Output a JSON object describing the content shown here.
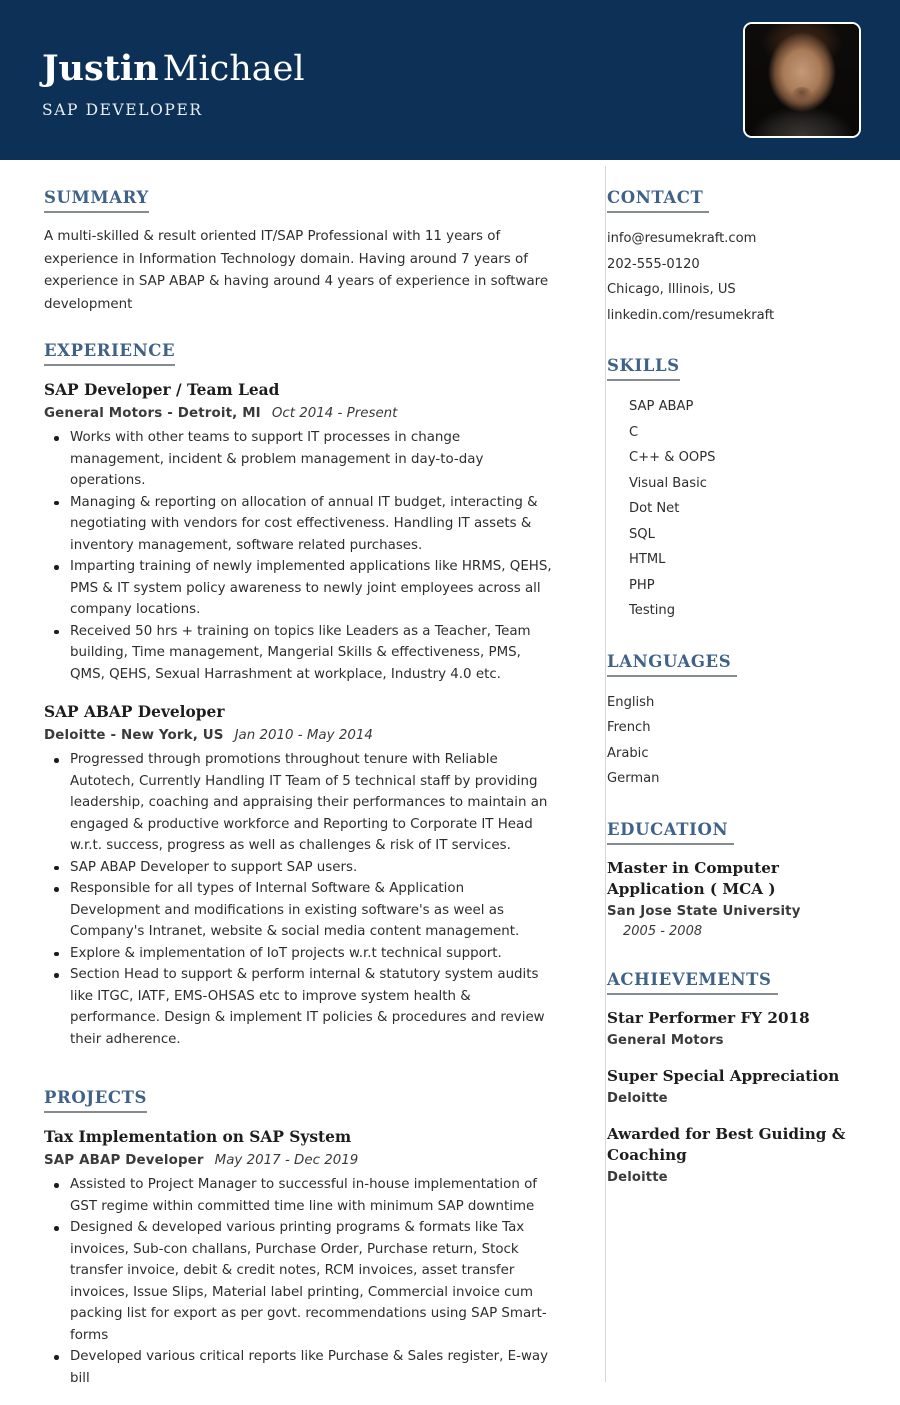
{
  "header": {
    "first_name": "Justin",
    "last_name": "Michael",
    "job_title": "SAP DEVELOPER",
    "photo_alt": "profile-photo",
    "background_color": "#0d3057"
  },
  "theme": {
    "accent": "#3f6289",
    "navy": "#0d3057",
    "rule": "#868b90",
    "divider": "#d3d7db"
  },
  "left": {
    "summary": {
      "heading": "SUMMARY",
      "text": "A multi-skilled & result oriented IT/SAP Professional with 11 years of experience in Information Technology domain. Having around 7 years of experience in SAP ABAP & having around 4 years of experience in software development"
    },
    "experience": {
      "heading": "EXPERIENCE",
      "entries": [
        {
          "title": "SAP Developer / Team Lead",
          "org": "General Motors - Detroit, MI",
          "dates": "Oct 2014 - Present",
          "bullets": [
            "Works with other teams to support IT processes in change management, incident & problem management in day-to-day operations.",
            "Managing & reporting on allocation of annual IT budget, interacting & negotiating with vendors for cost effectiveness. Handling IT assets & inventory management, software related purchases.",
            "Imparting training of newly implemented applications like HRMS, QEHS, PMS & IT system policy awareness to newly joint employees across all company locations.",
            "Received 50 hrs + training on topics like Leaders as a Teacher, Team building, Time management, Mangerial Skills & effectiveness, PMS, QMS, QEHS, Sexual Harrashment at workplace, Industry 4.0 etc."
          ]
        },
        {
          "title": "SAP ABAP Developer",
          "org": "Deloitte - New York, US",
          "dates": "Jan 2010 - May 2014",
          "bullets": [
            "Progressed through promotions throughout tenure with Reliable Autotech, Currently Handling IT Team of 5 technical staff by providing leadership, coaching and appraising their performances to maintain an engaged & productive workforce and Reporting to Corporate IT Head w.r.t. success, progress as well as challenges & risk of IT services.",
            "SAP ABAP Developer to support SAP users.",
            "Responsible for all types of Internal Software & Application Development and modifications in existing software's as weel as Company's Intranet, website & social media content management.",
            "Explore & implementation of IoT projects w.r.t technical support.",
            "Section Head to support & perform internal & statutory system audits like ITGC, IATF, EMS-OHSAS etc to improve system health & performance. Design & implement IT policies & procedures and review their adherence."
          ]
        }
      ]
    },
    "projects": {
      "heading": "PROJECTS",
      "entries": [
        {
          "title": "Tax Implementation on SAP System",
          "org": "SAP ABAP Developer",
          "dates": "May 2017 - Dec 2019",
          "bullets": [
            "Assisted to Project Manager to successful in-house implementation of GST regime within committed time line with minimum SAP downtime",
            "Designed & developed various printing programs & formats like Tax invoices, Sub-con challans, Purchase Order, Purchase return, Stock transfer invoice, debit & credit notes, RCM invoices, asset transfer invoices, Issue Slips, Material label printing, Commercial invoice cum packing list for export as per govt. recommendations using SAP Smart-forms",
            "Developed various critical reports like Purchase & Sales register, E-way bill"
          ]
        }
      ]
    }
  },
  "right": {
    "contact": {
      "heading": "CONTACT",
      "email": "info@resumekraft.com",
      "phone": "202-555-0120",
      "location": "Chicago, Illinois, US",
      "linkedin": "linkedin.com/resumekraft"
    },
    "skills": {
      "heading": "SKILLS",
      "items": [
        "SAP ABAP",
        "C",
        "C++ & OOPS",
        "Visual Basic",
        "Dot Net",
        "SQL",
        "HTML",
        "PHP",
        "Testing"
      ]
    },
    "languages": {
      "heading": "LANGUAGES",
      "items": [
        "English",
        "French",
        "Arabic",
        "German"
      ]
    },
    "education": {
      "heading": "EDUCATION",
      "entries": [
        {
          "degree": "Master in Computer Application ( MCA )",
          "school": "San Jose State University",
          "dates": "2005 - 2008"
        }
      ]
    },
    "achievements": {
      "heading": "ACHIEVEMENTS",
      "entries": [
        {
          "title": "Star Performer FY 2018",
          "org": "General Motors"
        },
        {
          "title": "Super Special Appreciation",
          "org": "Deloitte"
        },
        {
          "title": "Awarded for Best Guiding & Coaching",
          "org": "Deloitte"
        }
      ]
    }
  }
}
